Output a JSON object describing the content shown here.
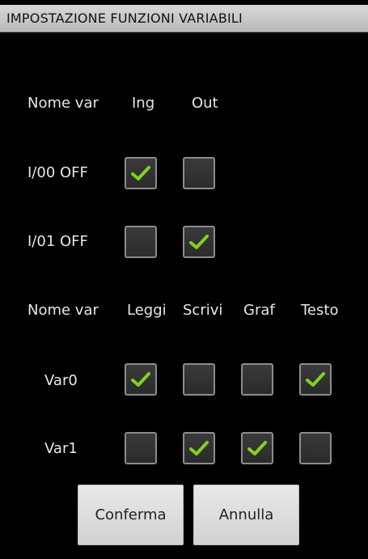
{
  "title": "IMPOSTAZIONE FUNZIONI VARIABILI",
  "io_section": {
    "headers": [
      "Nome var",
      "Ing",
      "Out"
    ],
    "rows": [
      {
        "name": "I/00 OFF",
        "ing": true,
        "out": false
      },
      {
        "name": "I/01 OFF",
        "ing": false,
        "out": true
      }
    ]
  },
  "var_section": {
    "headers": [
      "Nome var",
      "Leggi",
      "Scrivi",
      "Graf",
      "Testo"
    ],
    "rows": [
      {
        "name": "Var0",
        "leggi": true,
        "scrivi": false,
        "graf": false,
        "testo": true
      },
      {
        "name": "Var1",
        "leggi": false,
        "scrivi": true,
        "graf": true,
        "testo": false
      }
    ]
  },
  "buttons": {
    "confirm": "Conferma",
    "cancel": "Annulla"
  },
  "colors": {
    "check": "#7ed321",
    "background": "#000000",
    "titlebar": "#c8c8c8"
  },
  "icons": {
    "checkbox_mark": "check-icon"
  }
}
